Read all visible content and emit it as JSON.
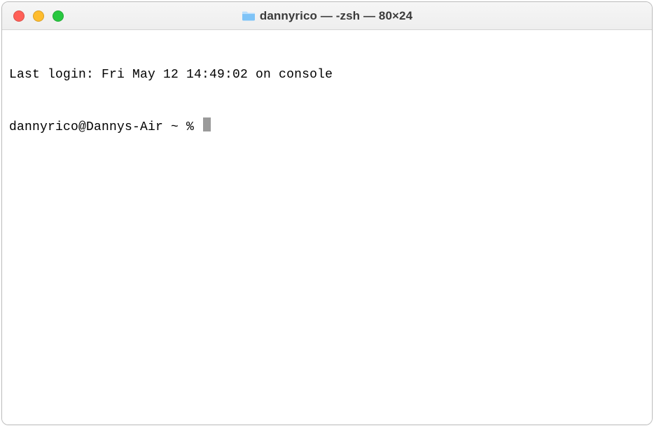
{
  "titlebar": {
    "title": "dannyrico — -zsh — 80×24",
    "folder_icon_name": "folder-icon"
  },
  "terminal": {
    "last_login_line": "Last login: Fri May 12 14:49:02 on console",
    "prompt": "dannyrico@Dannys-Air ~ % "
  },
  "colors": {
    "close": "#ff5f57",
    "minimize": "#febc2e",
    "zoom": "#28c840",
    "folder_light": "#b9defd",
    "folder_dark": "#7ec3f7"
  }
}
